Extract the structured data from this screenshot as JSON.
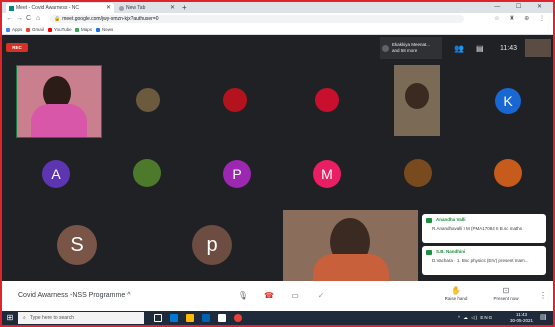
{
  "browser": {
    "tabs": [
      {
        "label": "Meet - Covid Awarness - NC",
        "active": true
      },
      {
        "label": "New Tab",
        "active": false
      }
    ],
    "new_tab": "+",
    "window_controls": "— ☐ ✕",
    "nav": {
      "back": "←",
      "forward": "→",
      "reload": "C",
      "home": "⌂"
    },
    "url": "meet.google.com/jwy-xmzn-kjx?authuser=0",
    "extensions": "☆ ♜ ⊕ ⋮",
    "bookmarks": [
      {
        "label": "Apps",
        "color": "#4285f4"
      },
      {
        "label": "Gmail",
        "color": "#ea4335"
      },
      {
        "label": "YouTube",
        "color": "#ff0000"
      },
      {
        "label": "Maps",
        "color": "#34a853"
      },
      {
        "label": "News",
        "color": "#1a73e8"
      }
    ]
  },
  "meet": {
    "rec_badge": "REC",
    "presenter_label": "Ekakkiya Meenat...\nand 58 more",
    "clock": "11:43",
    "participants": [
      {
        "type": "video",
        "color": "#c97f8d"
      },
      {
        "type": "photo",
        "color": "#6b5a3d"
      },
      {
        "type": "photo",
        "color": "#b3131c"
      },
      {
        "type": "photo",
        "color": "#c8102e"
      },
      {
        "type": "video",
        "color": "#7b6a56"
      },
      {
        "type": "letter",
        "letter": "K",
        "color": "#1967d2"
      },
      {
        "type": "letter",
        "letter": "A",
        "color": "#5e35b1"
      },
      {
        "type": "photo",
        "color": "#4c7a2a"
      },
      {
        "type": "letter",
        "letter": "P",
        "color": "#9c27b0"
      },
      {
        "type": "letter",
        "letter": "M",
        "color": "#e91e63"
      },
      {
        "type": "photo",
        "color": "#7a4a1f"
      },
      {
        "type": "photo",
        "color": "#c75b1c"
      },
      {
        "type": "letter",
        "letter": "S",
        "color": "#795548"
      },
      {
        "type": "letter",
        "letter": "p",
        "color": "#6d4c41"
      },
      {
        "type": "video",
        "color": "#8a6d5a"
      }
    ],
    "messages": [
      {
        "name": "Anandha Valli",
        "text": "R.Anandhavalli I M (PMA17084 II B.sc maths"
      },
      {
        "name": "S.B. Nandhini",
        "text": "D.Vachara · 1. Bsc physics (EIV) present mam..."
      }
    ]
  },
  "bottom": {
    "meeting_name": "Covid Awarness -NSS Programme",
    "chevron": "^",
    "mic": "🎙",
    "hangup": "☎",
    "camera": "▭",
    "more": "✓",
    "raise_hand": "Raise hand",
    "present_now": "Present now",
    "menu": "⋮"
  },
  "taskbar": {
    "start": "⊞",
    "search_placeholder": "Type here to search",
    "tray": "^ ☁ ◁) ENG",
    "time": "11:43",
    "date": "30-05-2021",
    "notifications": "▤"
  }
}
